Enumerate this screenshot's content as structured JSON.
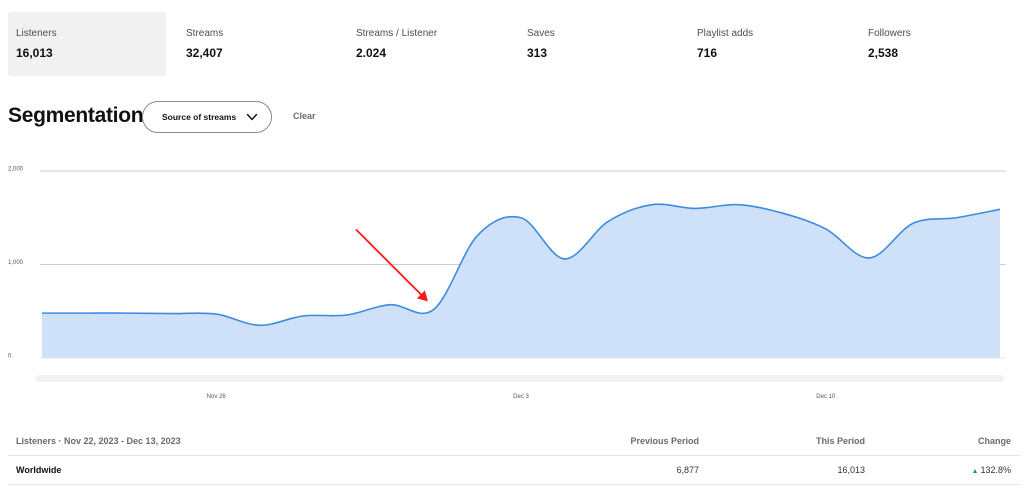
{
  "metrics": [
    {
      "label": "Listeners",
      "value": "16,013",
      "active": true
    },
    {
      "label": "Streams",
      "value": "32,407",
      "active": false
    },
    {
      "label": "Streams / Listener",
      "value": "2.024",
      "active": false
    },
    {
      "label": "Saves",
      "value": "313",
      "active": false
    },
    {
      "label": "Playlist adds",
      "value": "716",
      "active": false
    },
    {
      "label": "Followers",
      "value": "2,538",
      "active": false
    }
  ],
  "segmentation": {
    "title": "Segmentation",
    "dropdown_label": "Source of streams",
    "clear_label": "Clear"
  },
  "chart_data": {
    "type": "area",
    "x": [
      "Nov 22",
      "Nov 23",
      "Nov 24",
      "Nov 25",
      "Nov 26",
      "Nov 27",
      "Nov 28",
      "Nov 29",
      "Nov 30",
      "Dec 1",
      "Dec 2",
      "Dec 3",
      "Dec 4",
      "Dec 5",
      "Dec 6",
      "Dec 7",
      "Dec 8",
      "Dec 9",
      "Dec 10",
      "Dec 11",
      "Dec 12",
      "Dec 13"
    ],
    "series": [
      {
        "values": [
          480,
          480,
          480,
          475,
          470,
          350,
          450,
          460,
          570,
          520,
          1310,
          1500,
          1060,
          1460,
          1640,
          1600,
          1640,
          1550,
          1380,
          1070,
          1440,
          1500,
          1590
        ]
      }
    ],
    "y_ticks": [
      "0",
      "1,000",
      "2,000"
    ],
    "ylim": [
      0,
      2000
    ],
    "x_tick_labels": [
      "Nov 26",
      "Dec 3",
      "Dec 10"
    ],
    "colors": {
      "line": "#3d8be0",
      "fill": "#cfe1f8",
      "grid": "#bdbdbd",
      "axis": "#dcdcdc",
      "scroll_track": "#f2f2f2"
    },
    "annotation": {
      "type": "red-arrow",
      "target": "Dec 1",
      "color": "#ff1a1a"
    }
  },
  "table": {
    "header": {
      "name": "Listeners · Nov 22, 2023 - Dec 13, 2023",
      "prev": "Previous Period",
      "this": "This Period",
      "change": "Change"
    },
    "rows": [
      {
        "name": "Worldwide",
        "prev": "6,877",
        "this": "16,013",
        "change": "132.8%",
        "trend_icon": "up-triangle-icon",
        "trend_color": "#1e9c52"
      }
    ]
  }
}
